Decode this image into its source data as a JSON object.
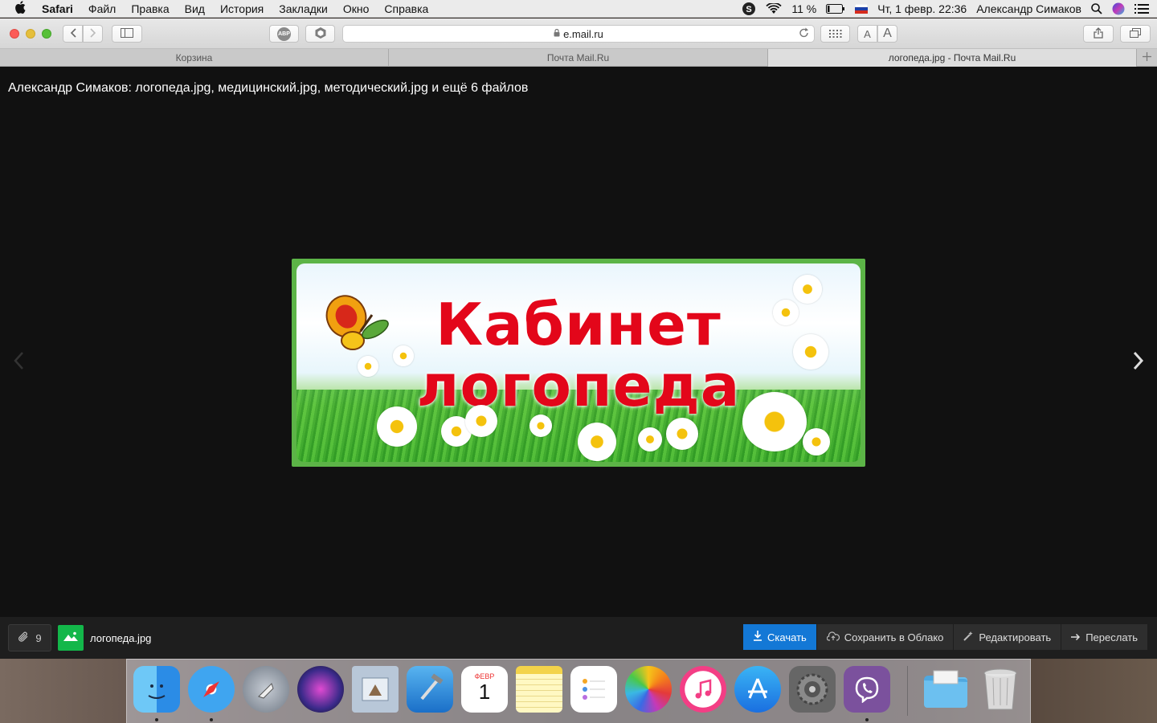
{
  "menubar": {
    "apple": "",
    "app_name": "Safari",
    "items": [
      "Файл",
      "Правка",
      "Вид",
      "История",
      "Закладки",
      "Окно",
      "Справка"
    ],
    "battery": "11 %",
    "datetime": "Чт, 1 февр.  22:36",
    "user": "Александр Симаков"
  },
  "toolbar": {
    "adblock_label": "ABP",
    "url": "e.mail.ru",
    "font_small": "A",
    "font_large": "A"
  },
  "tabs": [
    {
      "label": "Корзина"
    },
    {
      "label": "Почта Mail.Ru"
    },
    {
      "label": "логопеда.jpg - Почта Mail.Ru"
    }
  ],
  "viewer": {
    "title": "Александр Симаков: логопеда.jpg, медицинский.jpg, методический.jpg и ещё 6 файлов",
    "prev_glyph": "‹",
    "next_glyph": "›",
    "banner_line1": "Кабинет",
    "banner_line2": "логопеда"
  },
  "attachments": {
    "count": "9",
    "file_name": "логопеда.jpg",
    "actions": {
      "download": "Скачать",
      "save_cloud": "Сохранить в Облако",
      "edit": "Редактировать",
      "forward": "Переслать"
    }
  },
  "dock": {
    "calendar_month": "ФЕВР",
    "calendar_day": "1"
  },
  "colors": {
    "accent": "#1378d6",
    "banner_text": "#e3061a",
    "file_thumb": "#13b74a"
  }
}
